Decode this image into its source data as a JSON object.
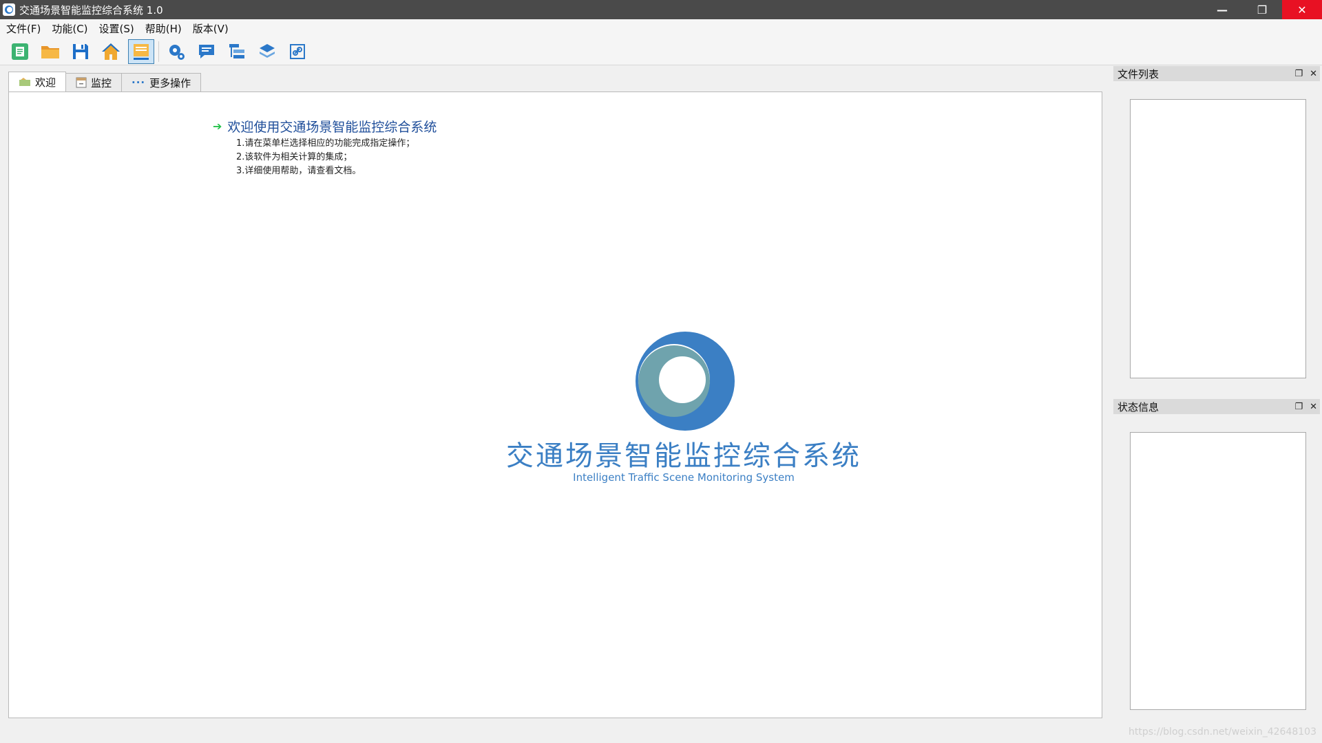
{
  "window": {
    "title": "交通场景智能监控综合系统 1.0",
    "controls": {
      "minimize": "—",
      "restore": "❐",
      "close": "✕"
    }
  },
  "menu": {
    "items": [
      "文件(F)",
      "功能(C)",
      "设置(S)",
      "帮助(H)",
      "版本(V)"
    ]
  },
  "toolbar": {
    "buttons": [
      {
        "icon": "new-document-icon",
        "color": "#3cb371"
      },
      {
        "icon": "open-folder-icon",
        "color": "#f0a830"
      },
      {
        "icon": "save-icon",
        "color": "#1e6fc8"
      },
      {
        "icon": "home-icon",
        "color": "#f0a830"
      },
      {
        "icon": "monitor-icon",
        "color": "#f0a830",
        "active": true
      },
      {
        "icon": "settings-icon",
        "color": "#2b78c9"
      },
      {
        "icon": "message-icon",
        "color": "#2b78c9"
      },
      {
        "icon": "tree-list-icon",
        "color": "#2b78c9"
      },
      {
        "icon": "layers-icon",
        "color": "#2b78c9"
      },
      {
        "icon": "link-icon",
        "color": "#2b78c9"
      }
    ]
  },
  "tabs": [
    {
      "label": "欢迎",
      "icon": "welcome-icon",
      "active": true
    },
    {
      "label": "监控",
      "icon": "monitor-tab-icon",
      "active": false
    },
    {
      "label": "更多操作",
      "icon": "more-icon",
      "active": false
    }
  ],
  "welcome": {
    "heading": "欢迎使用交通场景智能监控综合系统",
    "lines": [
      "1.请在菜单栏选择相应的功能完成指定操作；",
      "2.该软件为相关计算的集成；",
      "3.详细使用帮助，请查看文档。"
    ]
  },
  "logo": {
    "title": "交通场景智能监控综合系统",
    "subtitle": "Intelligent Traffic Scene Monitoring System",
    "primary_color": "#3b7fc4",
    "secondary_color": "#6fa3ad"
  },
  "panels": {
    "file_list": {
      "title": "文件列表"
    },
    "status_info": {
      "title": "状态信息"
    }
  },
  "watermark": "https://blog.csdn.net/weixin_42648103"
}
